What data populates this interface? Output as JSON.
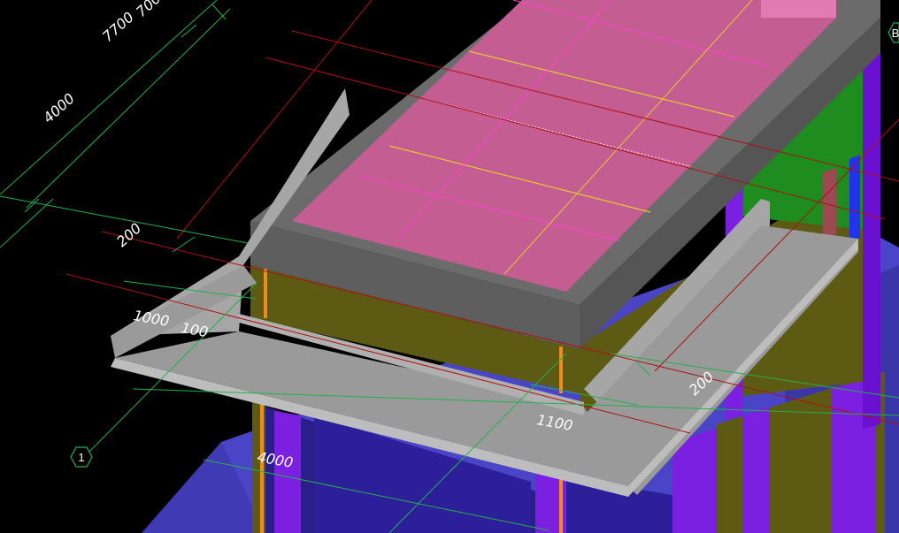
{
  "viewport": {
    "background": "#000000",
    "colors": {
      "roof": "#c45d92",
      "parapet": "#6b6b6b",
      "slab": "#9a9a9a",
      "wall_olive": "#5d5a14",
      "column_purple": "#7b1fe0",
      "base_blue": "#4a45c6",
      "green_wall": "#1e8c1e",
      "dim_green": "#22b14c",
      "axis_red": "#b01010",
      "grid_yellow": "#e6c830",
      "grid_pink": "#ff3fd0",
      "orange_strip": "#f08c1e"
    }
  },
  "dimensions": {
    "d_7700": "7700",
    "d_700": "700",
    "d_4000_upper": "4000",
    "d_200_left": "200",
    "d_1000": "1000",
    "d_100": "100",
    "d_1100": "1100",
    "d_200_right": "200",
    "d_4000_lower": "4000"
  },
  "grid_axes": {
    "axis_1": "1",
    "axis_top_right": "B"
  }
}
